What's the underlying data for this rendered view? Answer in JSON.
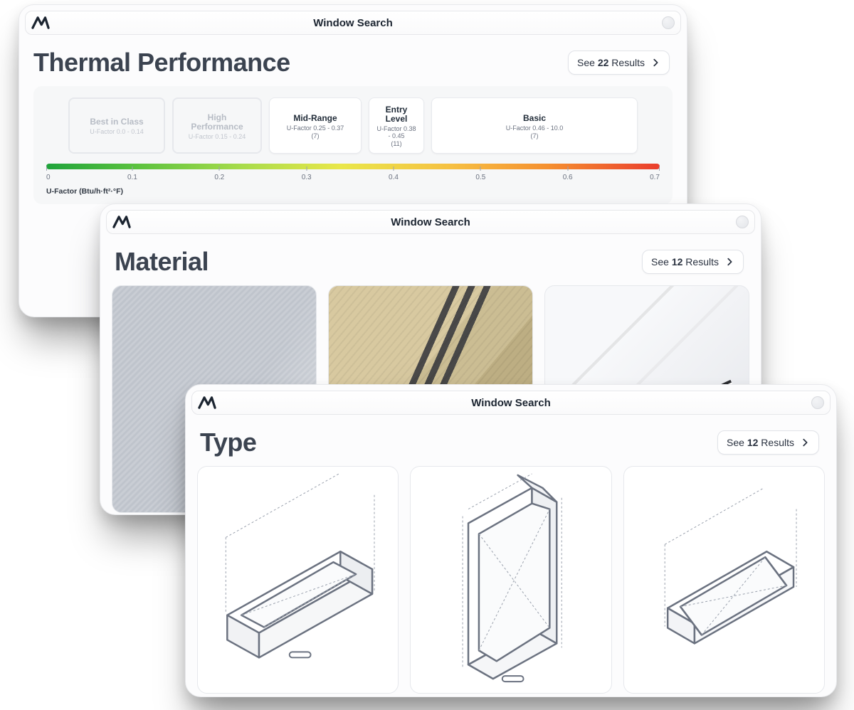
{
  "app_title": "Window Search",
  "see_results": {
    "prefix": "See ",
    "suffix": " Results"
  },
  "thermal": {
    "title": "Thermal Performance",
    "result_count": "22",
    "axis_label": "U-Factor (Btu/h·ft²·°F)",
    "ticks": [
      "0",
      "0.1",
      "0.2",
      "0.3",
      "0.4",
      "0.5",
      "0.6",
      "0.7"
    ],
    "tiers": [
      {
        "title": "Best in Class",
        "sub": "U-Factor 0.0 - 0.14",
        "count": "",
        "state": "disabled"
      },
      {
        "title": "High Performance",
        "sub": "U-Factor 0.15 - 0.24",
        "count": "",
        "state": "disabled"
      },
      {
        "title": "Mid-Range",
        "sub": "U-Factor 0.25 - 0.37",
        "count": "(7)",
        "state": "active"
      },
      {
        "title": "Entry Level",
        "sub": "U-Factor 0.38 - 0.45",
        "count": "(11)",
        "state": "active"
      },
      {
        "title": "Basic",
        "sub": "U-Factor 0.46 - 10.0",
        "count": "(7)",
        "state": "active"
      }
    ]
  },
  "material": {
    "title": "Material",
    "result_count": "12"
  },
  "type": {
    "title": "Type",
    "result_count": "12"
  }
}
